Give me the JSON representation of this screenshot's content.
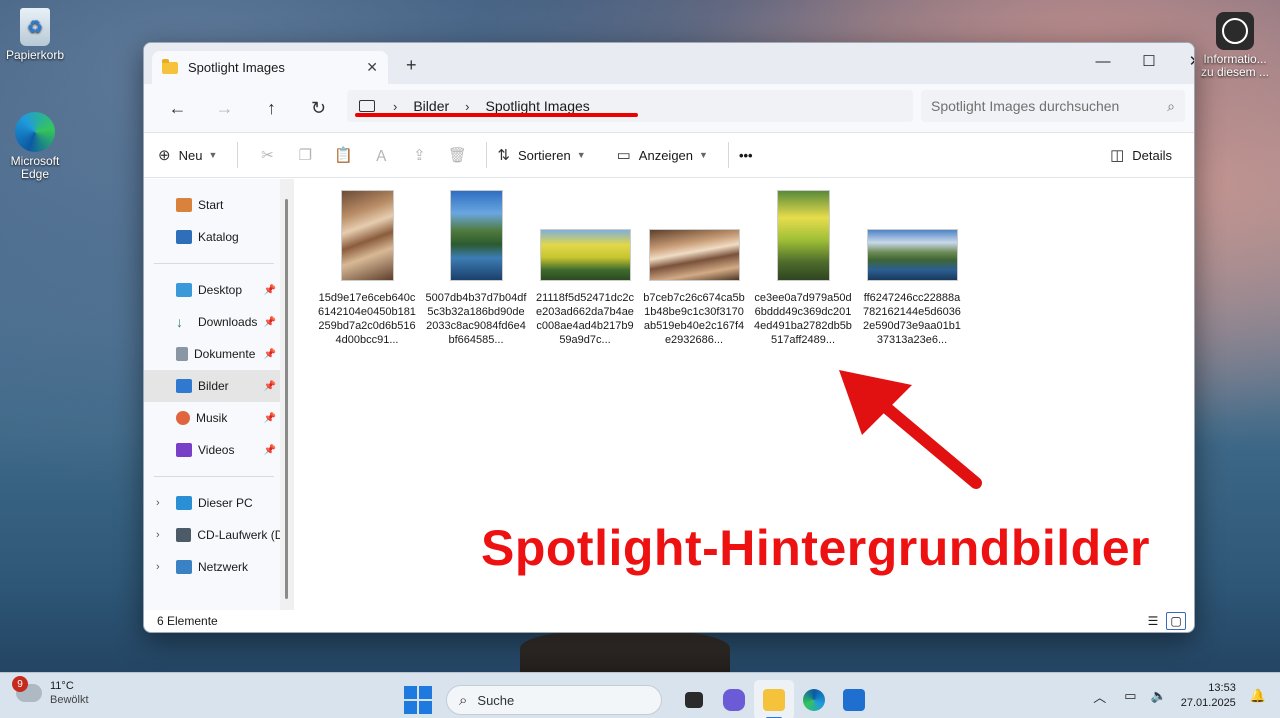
{
  "desktop": {
    "icons": [
      {
        "label": "Papierkorb"
      },
      {
        "label": "Microsoft Edge"
      },
      {
        "label": "Informatio... zu diesem ..."
      }
    ]
  },
  "window": {
    "tab_title": "Spotlight Images",
    "breadcrumb": [
      "Bilder",
      "Spotlight Images"
    ],
    "search_placeholder": "Spotlight Images durchsuchen",
    "toolbar": {
      "new_label": "Neu",
      "sort_label": "Sortieren",
      "view_label": "Anzeigen",
      "more_label": "•••",
      "details_label": "Details"
    },
    "sidebar": {
      "quick": [
        {
          "label": "Start"
        },
        {
          "label": "Katalog"
        }
      ],
      "pinned": [
        {
          "label": "Desktop"
        },
        {
          "label": "Downloads"
        },
        {
          "label": "Dokumente"
        },
        {
          "label": "Bilder"
        },
        {
          "label": "Musik"
        },
        {
          "label": "Videos"
        }
      ],
      "devices": [
        {
          "label": "Dieser PC"
        },
        {
          "label": "CD-Laufwerk (D"
        },
        {
          "label": "Netzwerk"
        }
      ]
    },
    "files": [
      {
        "name": "15d9e17e6ceb640c6142104e0450b181259bd7a2c0d6b5164d00bcc91..."
      },
      {
        "name": "5007db4b37d7b04df5c3b32a186bd90de2033c8ac9084fd6e4bf664585..."
      },
      {
        "name": "21118f5d52471dc2ce203ad662da7b4aec008ae4ad4b217b959a9d7c..."
      },
      {
        "name": "b7ceb7c26c674ca5b1b48be9c1c30f3170ab519eb40e2c167f4e2932686..."
      },
      {
        "name": "ce3ee0a7d979a50d6bddd49c369dc2014ed491ba2782db5b517aff2489..."
      },
      {
        "name": "ff6247246cc22888a782162144e5d60362e590d73e9aa01b137313a23e6..."
      }
    ],
    "annotation_text": "Spotlight-Hintergrundbilder",
    "status": "6 Elemente"
  },
  "taskbar": {
    "weather_temp": "11°C",
    "weather_desc": "Bewölkt",
    "weather_badge": "9",
    "search_label": "Suche",
    "time": "13:53",
    "date": "27.01.2025"
  },
  "colors": {
    "accent": "#1f7ae0",
    "annotation_red": "#e11111"
  }
}
